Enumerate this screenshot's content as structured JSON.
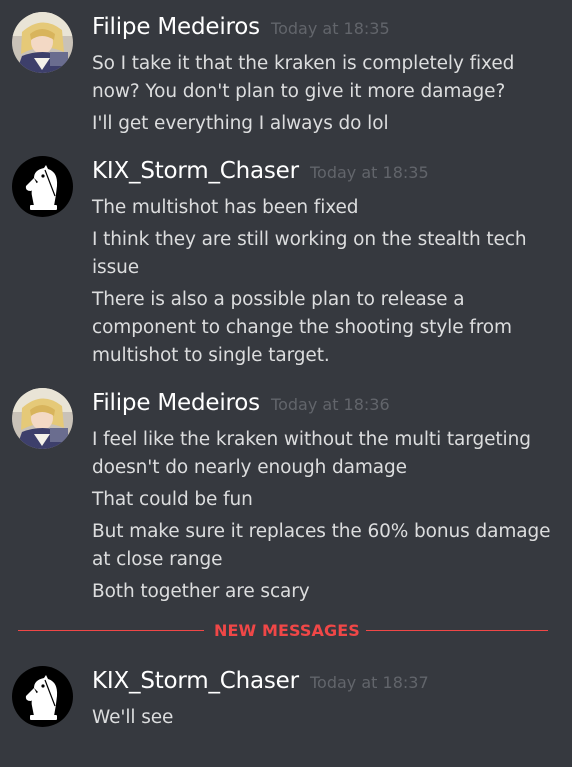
{
  "messages": [
    {
      "author": "Filipe Medeiros",
      "avatar": "anime-character-avatar",
      "timestamp": "Today at 18:35",
      "lines": [
        "So I take it that the kraken is completely fixed now? You don't plan to give it more damage?",
        "I'll get everything I always do lol"
      ]
    },
    {
      "author": "KIX_Storm_Chaser",
      "avatar": "chess-knight-avatar",
      "timestamp": "Today at 18:35",
      "lines": [
        "The multishot has been fixed",
        "I think they are still working on the stealth tech issue",
        "There is also a possible plan to release a component to change the shooting style from multishot to single target."
      ]
    },
    {
      "author": "Filipe Medeiros",
      "avatar": "anime-character-avatar",
      "timestamp": "Today at 18:36",
      "lines": [
        "I feel like the kraken without the multi targeting doesn't do nearly enough damage",
        "That could be fun",
        "But make sure it replaces the 60% bonus damage at close range",
        "Both together are scary"
      ]
    },
    {
      "author": "KIX_Storm_Chaser",
      "avatar": "chess-knight-avatar",
      "timestamp": "Today at 18:37",
      "lines": [
        "We'll see"
      ]
    }
  ],
  "divider": {
    "label": "NEW MESSAGES",
    "color": "#f04747"
  },
  "colors": {
    "background": "#36393f",
    "username": "#ffffff",
    "timestamp": "#62656b",
    "message_text": "#dcddde"
  }
}
